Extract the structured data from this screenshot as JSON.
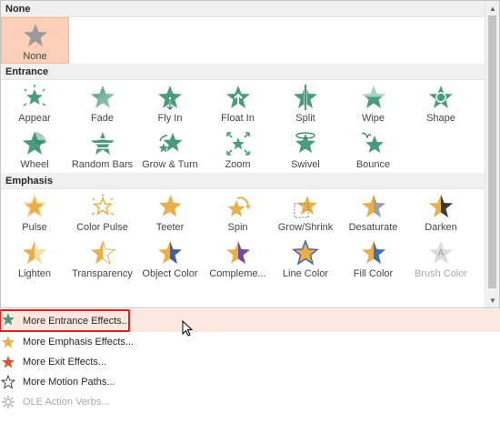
{
  "gallery": {
    "none_section": {
      "header": "None",
      "items": [
        {
          "label": "None",
          "icon": "star-gray-icon"
        }
      ]
    },
    "entrance_section": {
      "header": "Entrance",
      "items": [
        {
          "label": "Appear"
        },
        {
          "label": "Fade"
        },
        {
          "label": "Fly In"
        },
        {
          "label": "Float In"
        },
        {
          "label": "Split"
        },
        {
          "label": "Wipe"
        },
        {
          "label": "Shape"
        },
        {
          "label": "Wheel"
        },
        {
          "label": "Random Bars"
        },
        {
          "label": "Grow & Turn"
        },
        {
          "label": "Zoom"
        },
        {
          "label": "Swivel"
        },
        {
          "label": "Bounce"
        }
      ]
    },
    "emphasis_section": {
      "header": "Emphasis",
      "items": [
        {
          "label": "Pulse"
        },
        {
          "label": "Color Pulse"
        },
        {
          "label": "Teeter"
        },
        {
          "label": "Spin"
        },
        {
          "label": "Grow/Shrink"
        },
        {
          "label": "Desaturate"
        },
        {
          "label": "Darken"
        },
        {
          "label": "Lighten"
        },
        {
          "label": "Transparency"
        },
        {
          "label": "Object Color"
        },
        {
          "label": "Compleme..."
        },
        {
          "label": "Line Color"
        },
        {
          "label": "Fill Color"
        },
        {
          "label": "Brush Color"
        }
      ]
    }
  },
  "menu": {
    "items": [
      {
        "label": "More Entrance Effects...",
        "icon": "green-star-icon"
      },
      {
        "label": "More Emphasis Effects...",
        "icon": "gold-star-icon"
      },
      {
        "label": "More Exit Effects...",
        "icon": "red-star-icon"
      },
      {
        "label": "More Motion Paths...",
        "icon": "outline-star-icon"
      },
      {
        "label": "OLE Action Verbs...",
        "icon": "gear-icon"
      }
    ]
  },
  "colors": {
    "entrance": "#4a9a7c",
    "emphasis": "#e7b04a",
    "exit": "#d65533",
    "selected_bg": "#fcd0b8",
    "hover_bg": "#fde8df",
    "highlight_border": "#e02020"
  }
}
